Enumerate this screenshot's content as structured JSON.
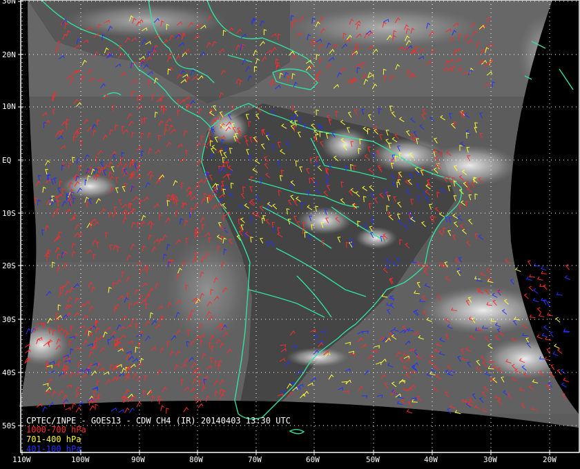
{
  "map": {
    "title": "CPTEC/INPE - GOES13 - CDW CH4 (IR) 20140403 13:30 UTC",
    "lat_labels": [
      "30N",
      "20N",
      "10N",
      "EQ",
      "10S",
      "20S",
      "30S",
      "40S",
      "50S"
    ],
    "lon_labels": [
      "110W",
      "100W",
      "90W",
      "80W",
      "70W",
      "60W",
      "50W",
      "40W",
      "30W",
      "20W"
    ],
    "legend": [
      {
        "label": "1000-700 hPa",
        "color": "#ff2a2a"
      },
      {
        "label": "701-400 hPa",
        "color": "#ffff33"
      },
      {
        "label": "401-100 hPa",
        "color": "#2233ff"
      }
    ],
    "coast_color": "#33e0a0",
    "grid_color": "#ffffff",
    "projection": "satellite full-disk, cropped"
  }
}
